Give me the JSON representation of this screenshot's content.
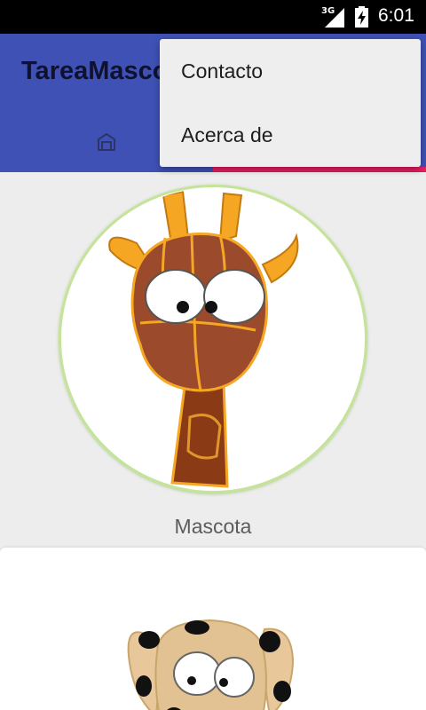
{
  "status_bar": {
    "network": "3G",
    "time": "6:01"
  },
  "toolbar": {
    "title": "TareaMascota",
    "tab_icon": "home-icon",
    "accent": "#e91e63",
    "primary": "#3f51b5"
  },
  "menu": {
    "items": [
      {
        "label": "Contacto"
      },
      {
        "label": "Acerca de"
      }
    ]
  },
  "pets": [
    {
      "name": "Mascota",
      "image": "giraffe-illustration"
    },
    {
      "image": "dalmatian-illustration"
    }
  ]
}
